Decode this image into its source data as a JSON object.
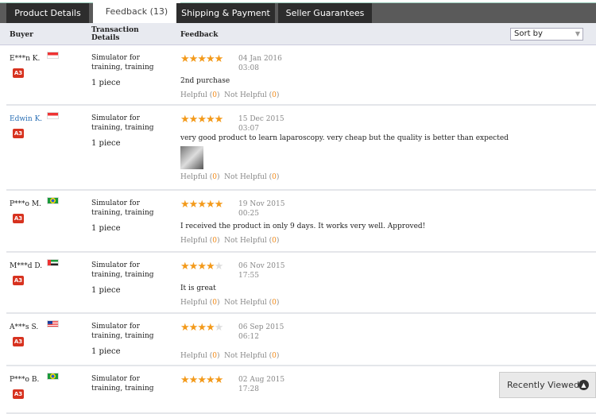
{
  "tabs": [
    {
      "label": "Product Details"
    },
    {
      "label": "Feedback (13)"
    },
    {
      "label": "Shipping & Payment"
    },
    {
      "label": "Seller Guarantees"
    }
  ],
  "header": {
    "buyer": "Buyer",
    "transaction": "Transaction Details",
    "feedback": "Feedback",
    "sort_label": "Sort by"
  },
  "helpful_label": "Helpful",
  "not_helpful_label": "Not Helpful",
  "reviews": [
    {
      "buyer": "E***n K.",
      "flag": "indonesia",
      "badge": "A3",
      "product": "Simulator for training, training",
      "qty": "1 piece",
      "rating": 5,
      "date": "04 Jan 2016",
      "time": "03:08",
      "text": "2nd purchase",
      "helpful": "0",
      "not_helpful": "0"
    },
    {
      "buyer": "Edwin K.",
      "flag": "indonesia",
      "badge": "A3",
      "product": "Simulator for training, training",
      "qty": "1 piece",
      "rating": 5,
      "date": "15 Dec 2015",
      "time": "03:07",
      "text": "very good product to learn laparoscopy. very cheap but the quality is better than expected",
      "helpful": "0",
      "not_helpful": "0",
      "has_photo": true
    },
    {
      "buyer": "P***o M.",
      "flag": "brazil",
      "badge": "A3",
      "product": "Simulator for training, training",
      "qty": "1 piece",
      "rating": 5,
      "date": "19 Nov 2015",
      "time": "00:25",
      "text": "I received the product in only 9 days. It works very well. Approved!",
      "helpful": "0",
      "not_helpful": "0"
    },
    {
      "buyer": "M***d D.",
      "flag": "uae",
      "badge": "A3",
      "product": "Simulator for training, training",
      "qty": "1 piece",
      "rating": 4,
      "date": "06 Nov 2015",
      "time": "17:55",
      "text": "It is great",
      "helpful": "0",
      "not_helpful": "0"
    },
    {
      "buyer": "A***s S.",
      "flag": "malaysia",
      "badge": "A3",
      "product": "Simulator for training, training",
      "qty": "1 piece",
      "rating": 4,
      "date": "06 Sep 2015",
      "time": "06:12",
      "text": "",
      "helpful": "0",
      "not_helpful": "0"
    },
    {
      "buyer": "P***o B.",
      "flag": "brazil",
      "badge": "A3",
      "product": "Simulator for training, training",
      "qty": "",
      "rating": 5,
      "date": "02 Aug 2015",
      "time": "17:28",
      "text": "",
      "helpful": "",
      "not_helpful": ""
    }
  ],
  "recently_viewed": {
    "label": "Recently Viewed",
    "icon": "chevron-up-icon"
  },
  "colors": {
    "star": "#f39a1b",
    "badge": "#d7321f",
    "link": "#2a6fb5",
    "count": "#f08a1a"
  }
}
